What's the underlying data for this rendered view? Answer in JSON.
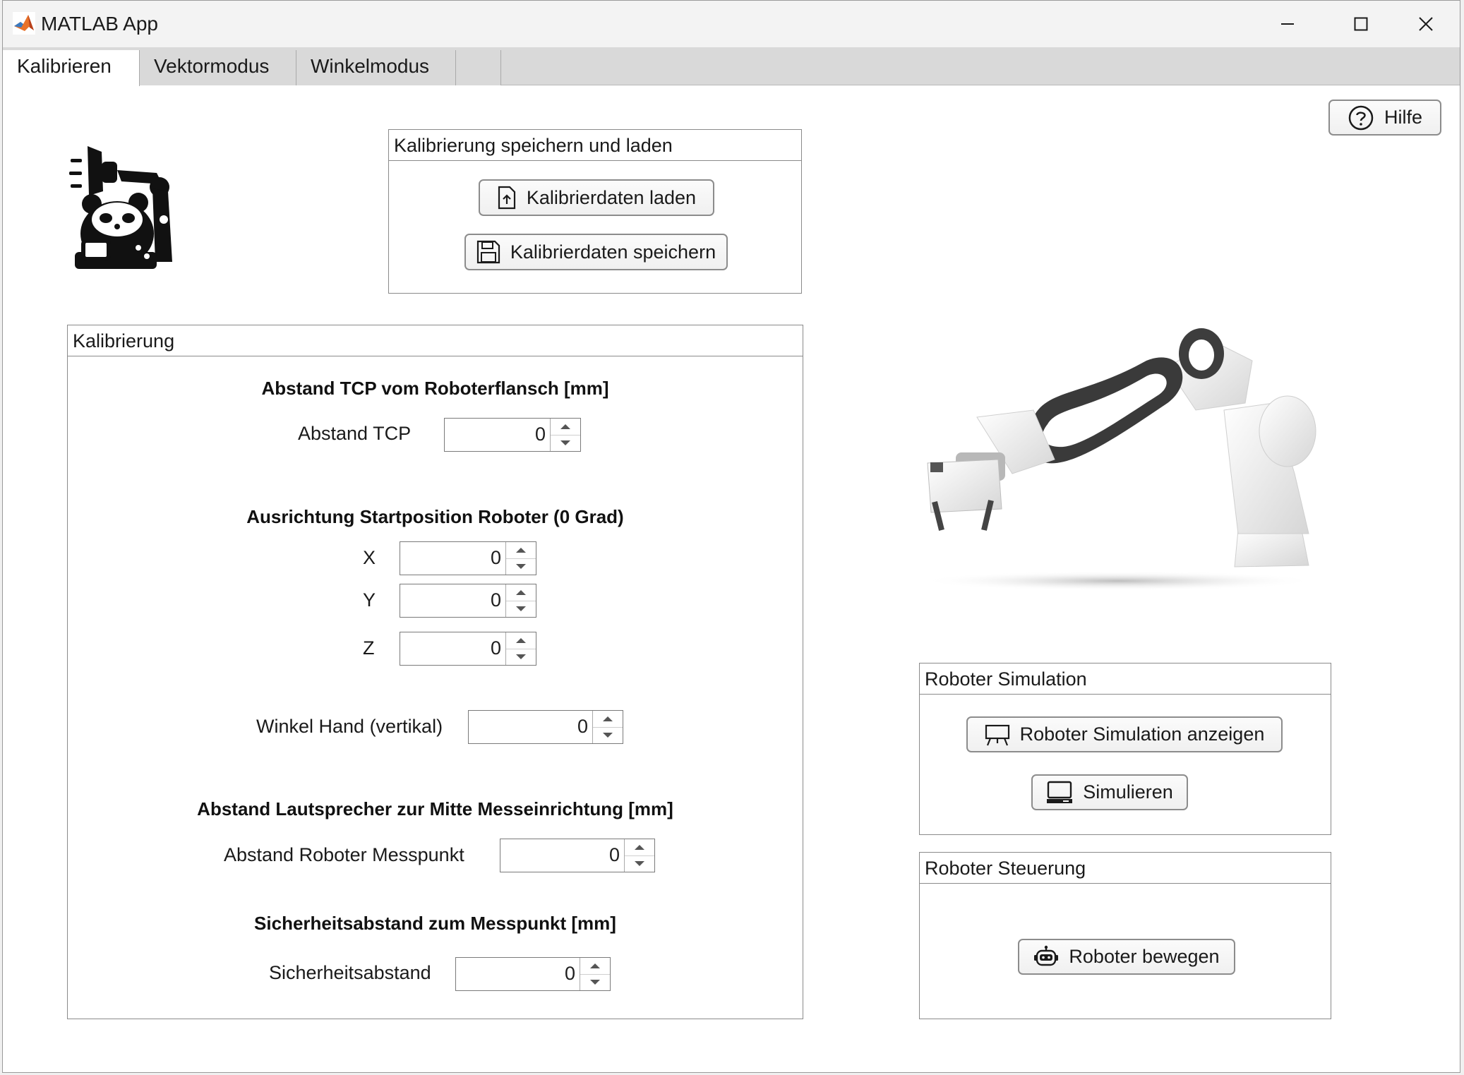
{
  "window": {
    "title": "MATLAB App"
  },
  "tabs": [
    {
      "label": "Kalibrieren"
    },
    {
      "label": "Vektormodus"
    },
    {
      "label": "Winkelmodus"
    },
    {
      "label": ""
    }
  ],
  "help": {
    "label": "Hilfe"
  },
  "save_load_panel": {
    "title": "Kalibrierung speichern und laden",
    "load_label": "Kalibrierdaten laden",
    "save_label": "Kalibrierdaten speichern"
  },
  "calibration_panel": {
    "title": "Kalibrierung",
    "tcp_heading": "Abstand TCP vom Roboterflansch [mm]",
    "tcp_label": "Abstand TCP",
    "tcp_value": "0",
    "orientation_heading": "Ausrichtung Startposition Roboter (0 Grad)",
    "x_label": "X",
    "x_value": "0",
    "y_label": "Y",
    "y_value": "0",
    "z_label": "Z",
    "z_value": "0",
    "hand_label": "Winkel Hand (vertikal)",
    "hand_value": "0",
    "speaker_heading": "Abstand Lautsprecher zur Mitte Messeinrichtung [mm]",
    "measure_label": "Abstand Roboter Messpunkt",
    "measure_value": "0",
    "safety_heading": "Sicherheitsabstand zum Messpunkt [mm]",
    "safety_label": "Sicherheitsabstand",
    "safety_value": "0"
  },
  "simulation_panel": {
    "title": "Roboter Simulation",
    "show_label": "Roboter Simulation anzeigen",
    "simulate_label": "Simulieren"
  },
  "control_panel": {
    "title": "Roboter Steuerung",
    "move_label": "Roboter bewegen"
  },
  "icons": {
    "app": "matlab-icon",
    "minimize": "minimize-icon",
    "maximize": "maximize-icon",
    "close": "close-icon",
    "help": "question-circle-icon",
    "load": "file-upload-icon",
    "save": "floppy-disk-icon",
    "show_sim": "presentation-board-icon",
    "simulate": "computer-icon",
    "move": "robot-icon",
    "logo": "panda-robot-arm-logo",
    "robot_image": "robot-arm-image"
  }
}
